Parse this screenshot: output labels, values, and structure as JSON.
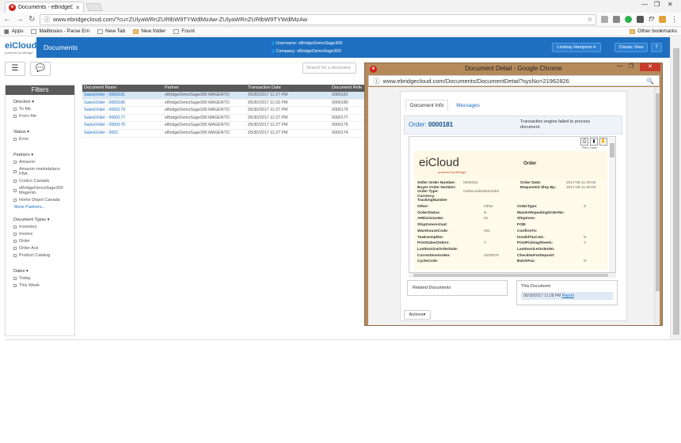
{
  "browser": {
    "tab_title": "Documents - eBridgeDe",
    "url": "www.ebridgecloud.com/?cu=ZUlyaWRnZURlbW9TYWdlMzAw-ZUlyaWRnZURlbW9TYWdlMzAw",
    "bookmarks": [
      "Apps",
      "Mailboxes - Parse Em",
      "New Tab",
      "New folder",
      "Fount"
    ],
    "other_bookmarks": "Other bookmarks"
  },
  "app": {
    "logo": "eiCloud",
    "logo_sub": "powered by eBridge",
    "nav_label": "Documents",
    "username_line": "Username: eBridgeDemoSage300",
    "company_line": "Company: eBridgeDemoSage300",
    "user_button": "Lindsay Hampson",
    "classic_view": "Classic View",
    "help": "?",
    "search_placeholder": "Search for a document"
  },
  "filters": {
    "title": "Filters",
    "direction": {
      "title": "Direction",
      "items": [
        "To Me",
        "From Me"
      ]
    },
    "status": {
      "title": "Status",
      "items": [
        "Error"
      ]
    },
    "partners": {
      "title": "Partners",
      "items": [
        "Amazon",
        "Amazon marketplace FBA",
        "Costco Canada",
        "eBridgeDemoSage300 Magento",
        "Home Depot Canada"
      ],
      "more": "More Partners..."
    },
    "doctypes": {
      "title": "Document Types",
      "items": [
        "Inventory",
        "Invoice",
        "Order",
        "Order Ack",
        "Product Catalog"
      ]
    },
    "dates": {
      "title": "Dates",
      "items": [
        "Today",
        "This Week"
      ]
    }
  },
  "table": {
    "headers": [
      "Document Name",
      "Partner",
      "Transaction Date",
      "Document Refe"
    ],
    "rows": [
      [
        "SalesOrder - 0000181",
        "eBridgeDemoSage300 MAGENTO",
        "05/30/2017 11:27 PM",
        "0000181"
      ],
      [
        "SalesOrder - 0000180",
        "eBridgeDemoSage300 MAGENTO",
        "05/30/2017 11:03 PM",
        "0000180"
      ],
      [
        "SalesOrder - 0000179",
        "eBridgeDemoSage300 MAGENTO",
        "05/30/2017 11:27 PM",
        "0000179"
      ],
      [
        "SalesOrder - 0000177",
        "eBridgeDemoSage300 MAGENTO",
        "05/30/2017 11:27 PM",
        "0000177"
      ],
      [
        "SalesOrder - 0000176",
        "eBridgeDemoSage300 MAGENTO",
        "05/30/2017 11:27 PM",
        "0000176"
      ],
      [
        "SalesOrder - 0001",
        "eBridgeDemoSage300 MAGENTO",
        "05/30/2017 11:27 PM",
        "0000174"
      ]
    ]
  },
  "popup": {
    "title": "Document Detail - Google Chrome",
    "url": "www.ebridgecloud.com/Documents/DocumentDetail?sysNo=21962826",
    "tabs": [
      "Document Info",
      "Messages"
    ],
    "order_label": "Order:",
    "order_no": "0000181",
    "message": "Transaction engine failed to process document.",
    "zoom_text": "Print | Close",
    "doc": {
      "logo": "eiCloud",
      "logo_sub": "powered by eBridge",
      "title": "Order",
      "left_top": [
        [
          "Seller Order Number:",
          "0000181"
        ],
        [
          "Buyer Order Number:",
          ""
        ],
        [
          "Order Type:",
          "OutboundSalesOrder"
        ],
        [
          "Currency:",
          ""
        ],
        [
          "TrackingNumber",
          ""
        ]
      ],
      "right_top": [
        [
          "Order Date:",
          "2017-05-11 00:00"
        ],
        [
          "Requested Ship By:",
          "2017-05-11 00:00"
        ]
      ],
      "left_fields": [
        [
          "Other:",
          "Other"
        ],
        [
          "OrderStatus:",
          "N"
        ],
        [
          "ARDivisionNo:",
          "01"
        ],
        [
          "ShipZoneActual:",
          ""
        ],
        [
          "WarehouseCode:",
          "001"
        ],
        [
          "TaxExemptNo:",
          ""
        ],
        [
          "PrintSalesOrders:",
          "Y"
        ],
        [
          "LastInvoiceOrderDate:",
          ""
        ],
        [
          "CurrentInvoiceNo:",
          "0100079"
        ],
        [
          "CycleCode:",
          ""
        ]
      ],
      "right_fields": [
        [
          "OrderType:",
          "S"
        ],
        [
          "MasterRepeatingOrderNo:",
          ""
        ],
        [
          "ShipZone:",
          ""
        ],
        [
          "FOB:",
          ""
        ],
        [
          "ConfirmTo:",
          ""
        ],
        [
          "InvalidTaxCalc:",
          "N"
        ],
        [
          "PrintPickingSheets:",
          "Y"
        ],
        [
          "LastInvoiceOrderNo:",
          ""
        ],
        [
          "CheckNoForDeposit:",
          ""
        ],
        [
          "BatchFax:",
          "N"
        ]
      ]
    },
    "related_docs": "Related Documents",
    "this_doc": "This Document",
    "this_doc_date": "05/30/2017 11:28 PM",
    "this_doc_link": "Report",
    "actions": "Actions"
  }
}
